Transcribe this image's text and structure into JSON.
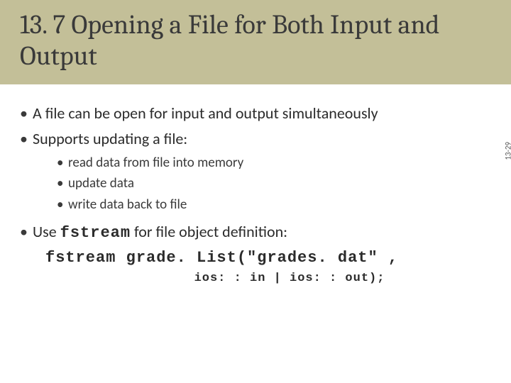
{
  "title": "13. 7 Opening a File for Both Input and Output",
  "bullets": {
    "b1": "A file can be open for input and output simultaneously",
    "b2": "Supports updating a file:",
    "sub1": "read data from file into memory",
    "sub2": "update data",
    "sub3": "write data back to file",
    "b3_pre": "Use ",
    "b3_code": "fstream",
    "b3_post": " for file object definition:"
  },
  "code": {
    "line1": "fstream grade. List(\"grades. dat\" ,",
    "line2": "ios: : in | ios: : out);"
  },
  "slide_number": "13-29"
}
